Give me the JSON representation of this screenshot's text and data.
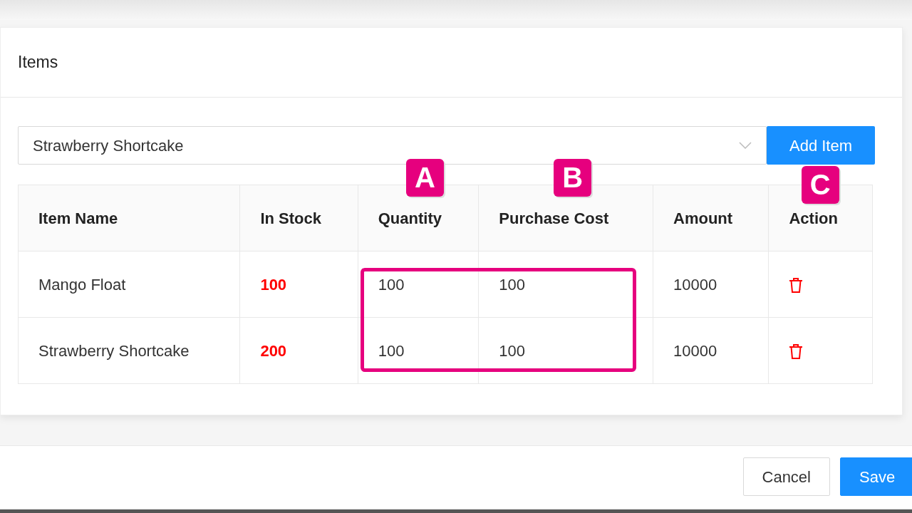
{
  "card": {
    "title": "Items"
  },
  "item_select": {
    "value": "Strawberry Shortcake"
  },
  "add_button": "Add Item",
  "table": {
    "columns": [
      {
        "label": "Item Name"
      },
      {
        "label": "In Stock"
      },
      {
        "label": "Quantity",
        "callout": "A"
      },
      {
        "label": "Purchase Cost",
        "callout": "B"
      },
      {
        "label": "Amount"
      },
      {
        "label": "Action",
        "callout": "C"
      }
    ],
    "rows": [
      {
        "name": "Mango Float",
        "in_stock": "100",
        "quantity": "100",
        "purchase_cost": "100",
        "amount": "10000"
      },
      {
        "name": "Strawberry Shortcake",
        "in_stock": "200",
        "quantity": "100",
        "purchase_cost": "100",
        "amount": "10000"
      }
    ]
  },
  "footer": {
    "buttons": [
      {
        "label": "Cancel",
        "kind": "secondary"
      },
      {
        "label": "Save",
        "kind": "primary"
      }
    ]
  }
}
